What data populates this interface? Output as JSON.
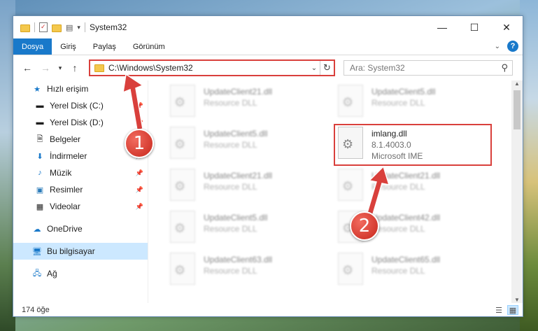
{
  "window": {
    "title": "System32",
    "controls": {
      "minimize": "—",
      "maximize": "☐",
      "close": "✕"
    }
  },
  "ribbon": {
    "tabs": [
      "Dosya",
      "Giriş",
      "Paylaş",
      "Görünüm"
    ],
    "active_tab": "Dosya",
    "help": "?"
  },
  "address": {
    "path": "C:\\Windows\\System32",
    "search_placeholder": "Ara: System32"
  },
  "navigation": {
    "quick_access": "Hızlı erişim",
    "pinned": [
      "Yerel Disk (C:)",
      "Yerel Disk (D:)",
      "Belgeler",
      "İndirmeler",
      "Müzik",
      "Resimler",
      "Videolar"
    ],
    "onedrive": "OneDrive",
    "this_pc": "Bu bilgisayar",
    "network": "Ağ"
  },
  "files": [
    {
      "name": "UpdateClient21.dll",
      "type": "Resource DLL",
      "blurred": true
    },
    {
      "name": "UpdateClient5.dll",
      "type": "Resource DLL",
      "blurred": true
    },
    {
      "name": "UpdateClient5.dll",
      "type": "Resource DLL",
      "blurred": true
    },
    {
      "name": "imlang.dll",
      "version": "8.1.4003.0",
      "company": "Microsoft IME",
      "blurred": false
    },
    {
      "name": "UpdateClient21.dll",
      "type": "Resource DLL",
      "blurred": true
    },
    {
      "name": "UpdateClient21.dll",
      "type": "Resource DLL",
      "blurred": true
    },
    {
      "name": "UpdateClient5.dll",
      "type": "Resource DLL",
      "blurred": true
    },
    {
      "name": "UpdateClient42.dll",
      "type": "Resource DLL",
      "blurred": true
    },
    {
      "name": "UpdateClient63.dll",
      "type": "Resource DLL",
      "blurred": true
    },
    {
      "name": "UpdateClient65.dll",
      "type": "Resource DLL",
      "blurred": true
    }
  ],
  "status": {
    "count": "174 öğe"
  },
  "callouts": [
    "1",
    "2"
  ],
  "colors": {
    "accent": "#1979ca",
    "highlight": "#d9403c",
    "selected": "#cce8ff"
  }
}
